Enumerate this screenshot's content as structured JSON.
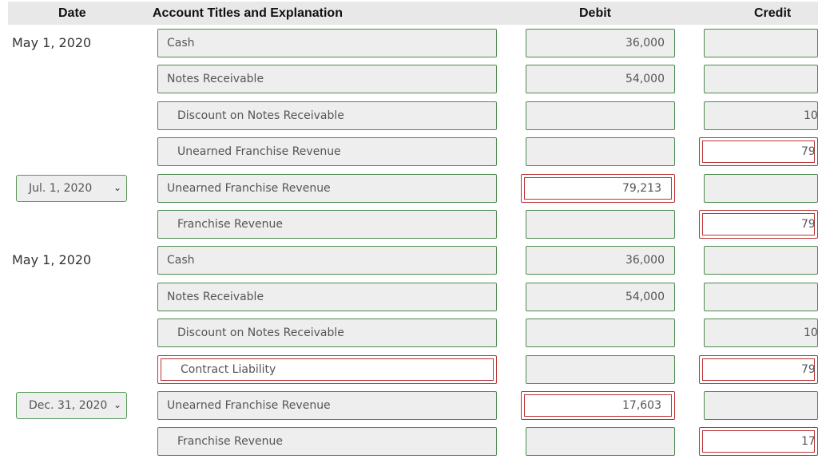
{
  "headers": {
    "date": "Date",
    "account": "Account Titles and Explanation",
    "debit": "Debit",
    "credit": "Credit"
  },
  "rows": [
    {
      "date": "May 1, 2020",
      "date_type": "text",
      "account": "Cash",
      "indent": false,
      "account_error": false,
      "debit": "36,000",
      "debit_error": false,
      "credit": "",
      "credit_error": false
    },
    {
      "date": "",
      "account": "Notes Receivable",
      "indent": false,
      "account_error": false,
      "debit": "54,000",
      "debit_error": false,
      "credit": "",
      "credit_error": false
    },
    {
      "date": "",
      "account": "Discount on Notes Receivable",
      "indent": true,
      "account_error": false,
      "debit": "",
      "debit_error": false,
      "credit": "10",
      "credit_error": false
    },
    {
      "date": "",
      "account": "Unearned Franchise Revenue",
      "indent": true,
      "account_error": false,
      "debit": "",
      "debit_error": false,
      "credit": "79",
      "credit_error": true
    },
    {
      "date": "Jul. 1, 2020",
      "date_type": "select",
      "account": "Unearned Franchise Revenue",
      "indent": false,
      "account_error": false,
      "debit": "79,213",
      "debit_error": true,
      "credit": "",
      "credit_error": false
    },
    {
      "date": "",
      "account": "Franchise Revenue",
      "indent": true,
      "account_error": false,
      "debit": "",
      "debit_error": false,
      "credit": "79",
      "credit_error": true
    },
    {
      "date": "May 1, 2020",
      "date_type": "text",
      "account": "Cash",
      "indent": false,
      "account_error": false,
      "debit": "36,000",
      "debit_error": false,
      "credit": "",
      "credit_error": false
    },
    {
      "date": "",
      "account": "Notes Receivable",
      "indent": false,
      "account_error": false,
      "debit": "54,000",
      "debit_error": false,
      "credit": "",
      "credit_error": false
    },
    {
      "date": "",
      "account": "Discount on Notes Receivable",
      "indent": true,
      "account_error": false,
      "debit": "",
      "debit_error": false,
      "credit": "10",
      "credit_error": false
    },
    {
      "date": "",
      "account": "Contract Liability",
      "indent": true,
      "account_error": true,
      "debit": "",
      "debit_error": false,
      "credit": "79",
      "credit_error": true
    },
    {
      "date": "Dec. 31, 2020",
      "date_type": "select",
      "account": "Unearned Franchise Revenue",
      "indent": false,
      "account_error": false,
      "debit": "17,603",
      "debit_error": true,
      "credit": "",
      "credit_error": false
    },
    {
      "date": "",
      "account": "Franchise Revenue",
      "indent": true,
      "account_error": false,
      "debit": "",
      "debit_error": false,
      "credit": "17",
      "credit_error": true
    }
  ]
}
